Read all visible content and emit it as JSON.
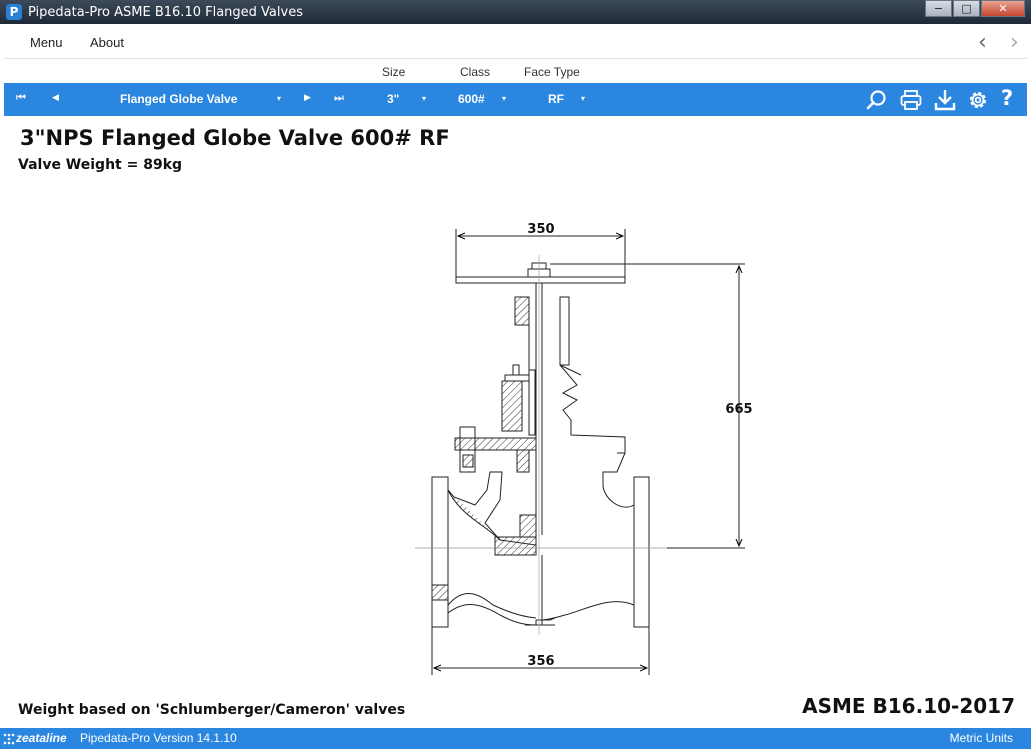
{
  "window": {
    "title": "Pipedata-Pro  ASME B16.10 Flanged Valves",
    "app_icon_letter": "P",
    "minimize": "−",
    "maximize": "□",
    "close": "✕"
  },
  "menu": {
    "items": [
      "Menu",
      "About"
    ],
    "back_arrow": "‹",
    "forward_arrow": "›"
  },
  "column_labels": {
    "size": "Size",
    "class": "Class",
    "face_type": "Face Type"
  },
  "toolbar": {
    "first": "⏮",
    "prev": "◀",
    "valve_type": "Flanged Globe Valve",
    "next": "▶",
    "last": "⏭",
    "size": "3\"",
    "class": "600#",
    "face_type": "RF",
    "dropdown_glyph": "▾",
    "icons": [
      "search-icon",
      "print-icon",
      "download-icon",
      "gear-icon",
      "help-icon"
    ],
    "help_glyph": "?"
  },
  "content": {
    "heading": "3\"NPS Flanged Globe Valve 600# RF",
    "weight": "Valve Weight = 89kg",
    "footnote": "Weight based on 'Schlumberger/Cameron' valves",
    "standard": "ASME B16.10-2017"
  },
  "drawing": {
    "handwheel_dim": "350",
    "height_dim": "665",
    "face_to_face_dim": "356"
  },
  "status": {
    "brand": "zeataline",
    "version": "Pipedata-Pro Version 14.1.10",
    "units": "Metric Units"
  },
  "colors": {
    "accent": "#2a86df",
    "titlebar": "#2b3744"
  }
}
